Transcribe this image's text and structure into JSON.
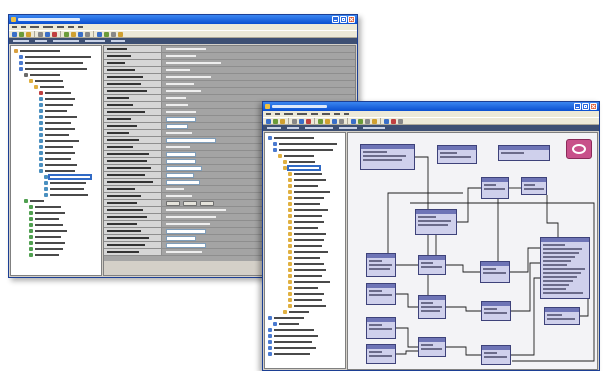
{
  "colors": {
    "titlebar-light": "#3b86f0",
    "titlebar-dark": "#0a4fd0",
    "close-button": "#d9532c",
    "nav-bar": "#3d4f73",
    "tree-selection": "#316ac5",
    "property-label-bg": "#d6d6d6",
    "property-value-bg": "#a4a4a4",
    "node-header": "#6e74b6",
    "node-body": "#cfd0ec",
    "connector": "#1e1e1e",
    "canvas-bg": "#f3f3f6",
    "logo": "#c8508a"
  },
  "icons": {
    "window_controls": [
      "minimize-icon",
      "maximize-icon",
      "close-icon"
    ],
    "canvas_badge": "logo-icon"
  }
}
